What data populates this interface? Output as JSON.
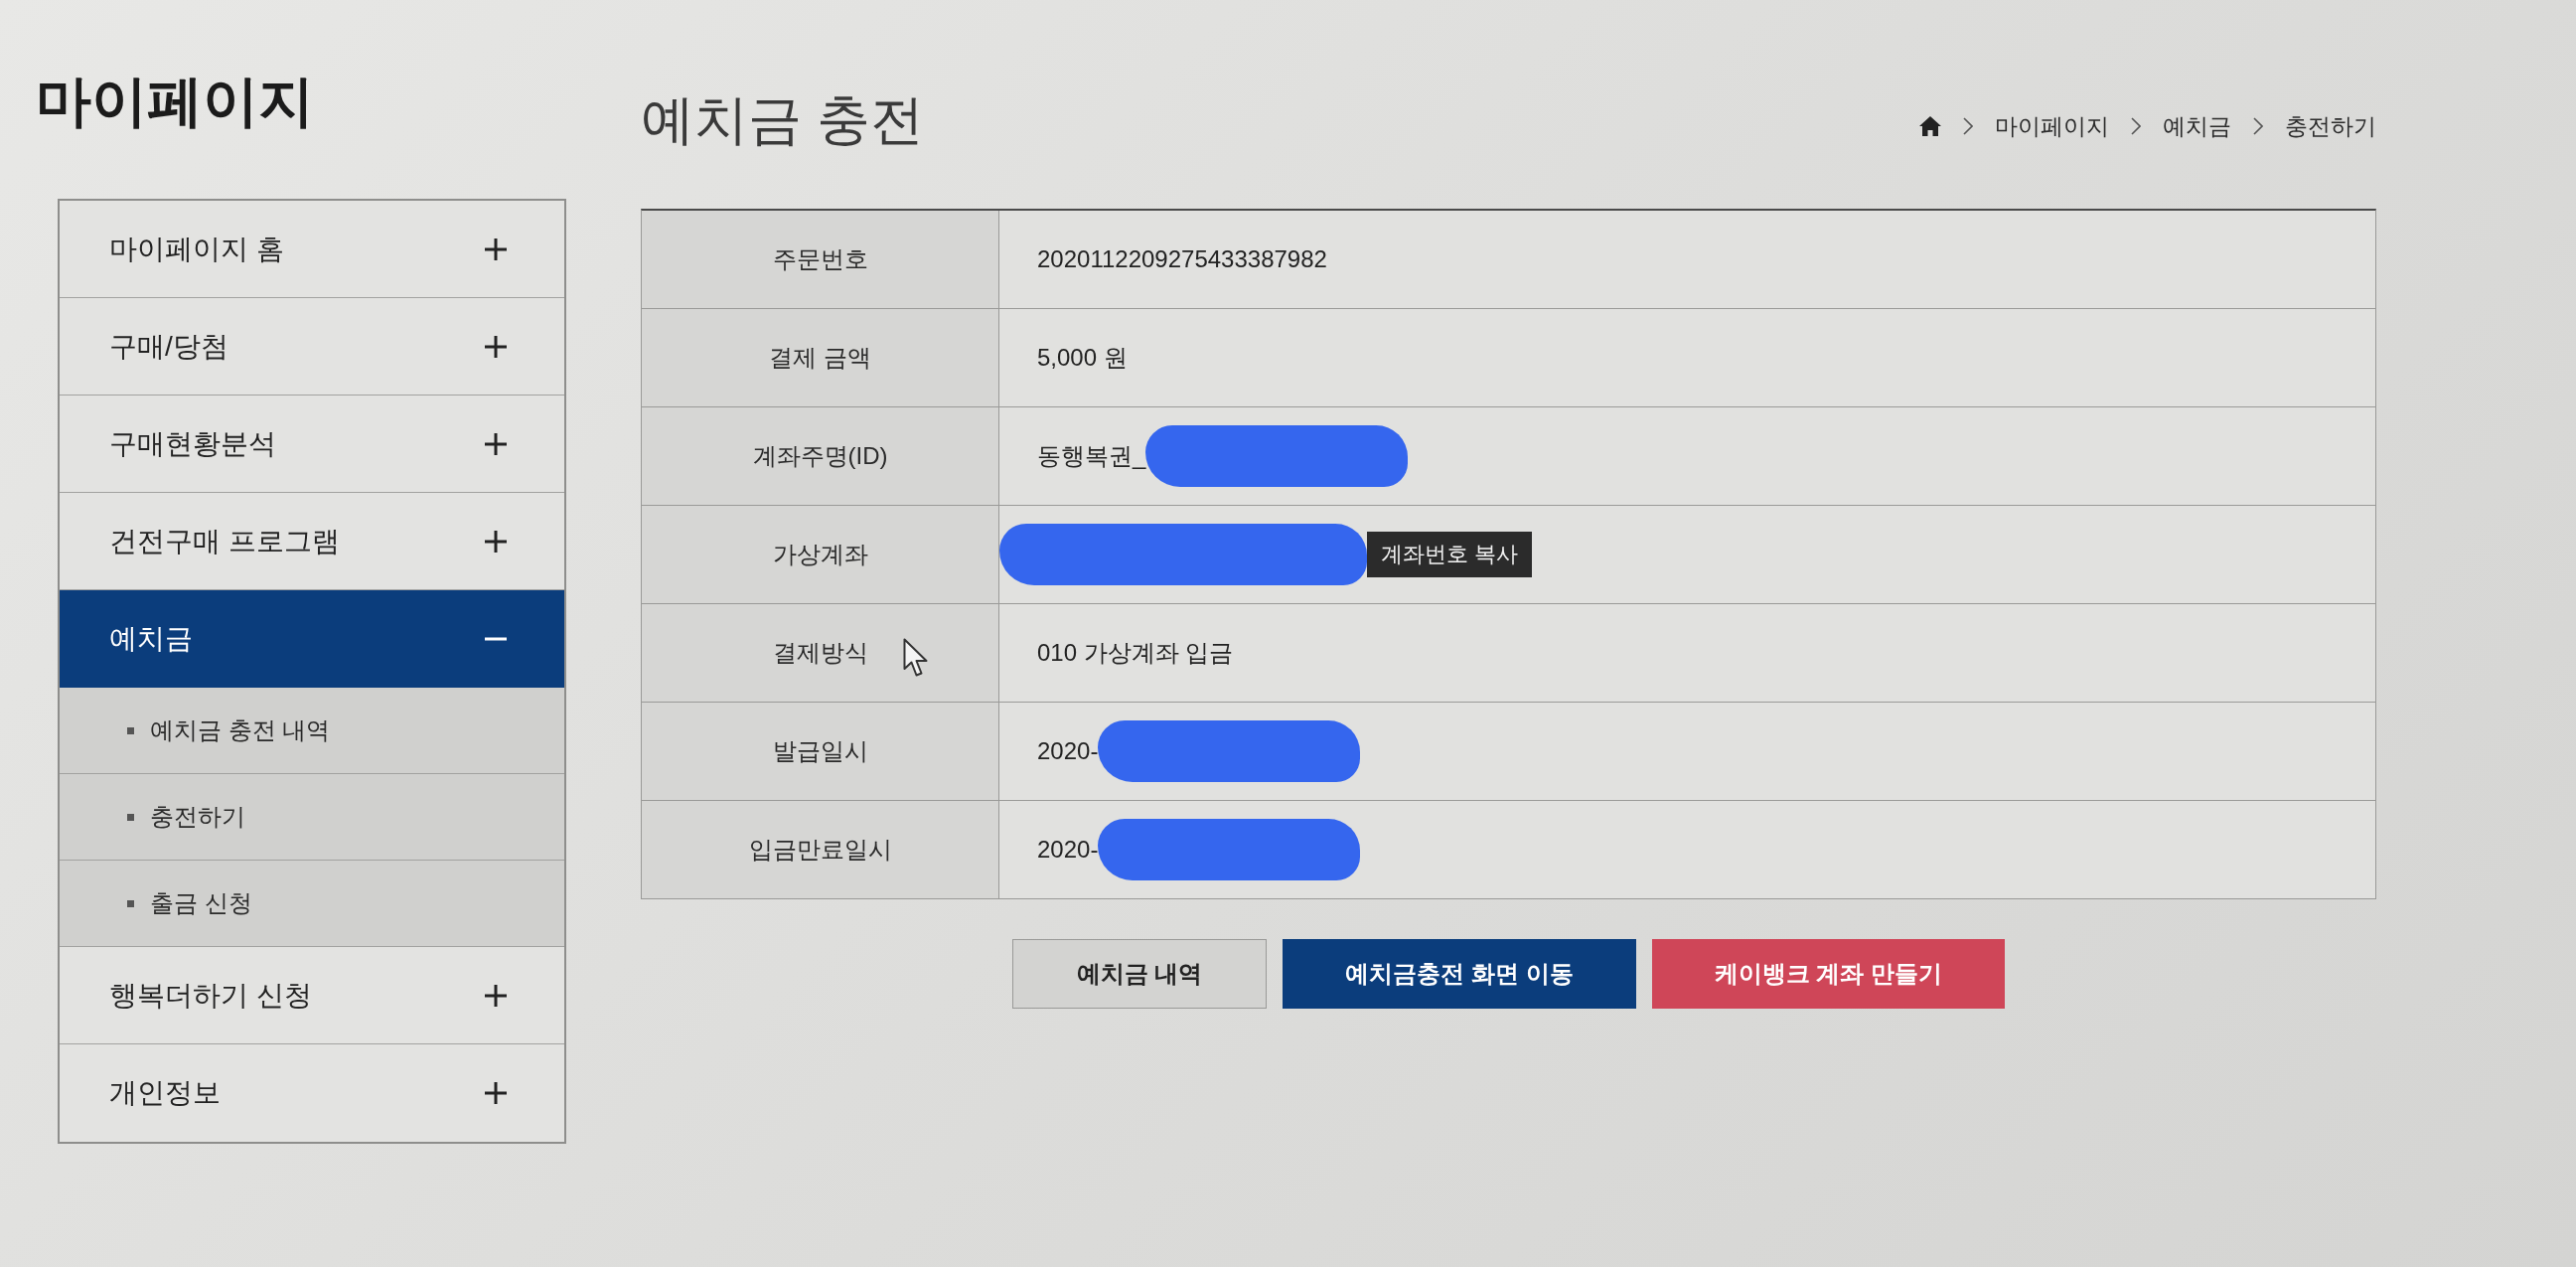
{
  "sidebar": {
    "title": "마이페이지",
    "items": [
      {
        "label": "마이페이지 홈",
        "expanded": false
      },
      {
        "label": "구매/당첨",
        "expanded": false
      },
      {
        "label": "구매현황분석",
        "expanded": false
      },
      {
        "label": "건전구매 프로그램",
        "expanded": false
      },
      {
        "label": "예치금",
        "expanded": true,
        "children": [
          {
            "label": "예치금 충전 내역"
          },
          {
            "label": "충전하기"
          },
          {
            "label": "출금 신청"
          }
        ]
      },
      {
        "label": "행복더하기 신청",
        "expanded": false
      },
      {
        "label": "개인정보",
        "expanded": false
      }
    ]
  },
  "page": {
    "title": "예치금 충전",
    "breadcrumb": [
      "마이페이지",
      "예치금",
      "충전하기"
    ]
  },
  "details": {
    "rows": [
      {
        "label": "주문번호",
        "value": "2020112209275433387982",
        "redacted": false,
        "cursor": false
      },
      {
        "label": "결제 금액",
        "value": "5,000 원",
        "redacted": false,
        "cursor": false
      },
      {
        "label": "계좌주명(ID)",
        "value": "동행복권_",
        "redacted": true,
        "cursor": false
      },
      {
        "label": "가상계좌",
        "redacted": true,
        "cursor": false,
        "action": "계좌번호 복사"
      },
      {
        "label": "결제방식",
        "value": "010 가상계좌 입금",
        "redacted": false,
        "cursor": true
      },
      {
        "label": "발급일시",
        "value": "2020-",
        "redacted": true,
        "cursor": false
      },
      {
        "label": "입금만료일시",
        "value": "2020-",
        "redacted": true,
        "cursor": false
      }
    ]
  },
  "buttons": [
    {
      "label": "예치금 내역",
      "kind": "secondary"
    },
    {
      "label": "예치금충전 화면 이동",
      "kind": "primary"
    },
    {
      "label": "케이뱅크 계좌 만들기",
      "kind": "danger"
    }
  ]
}
